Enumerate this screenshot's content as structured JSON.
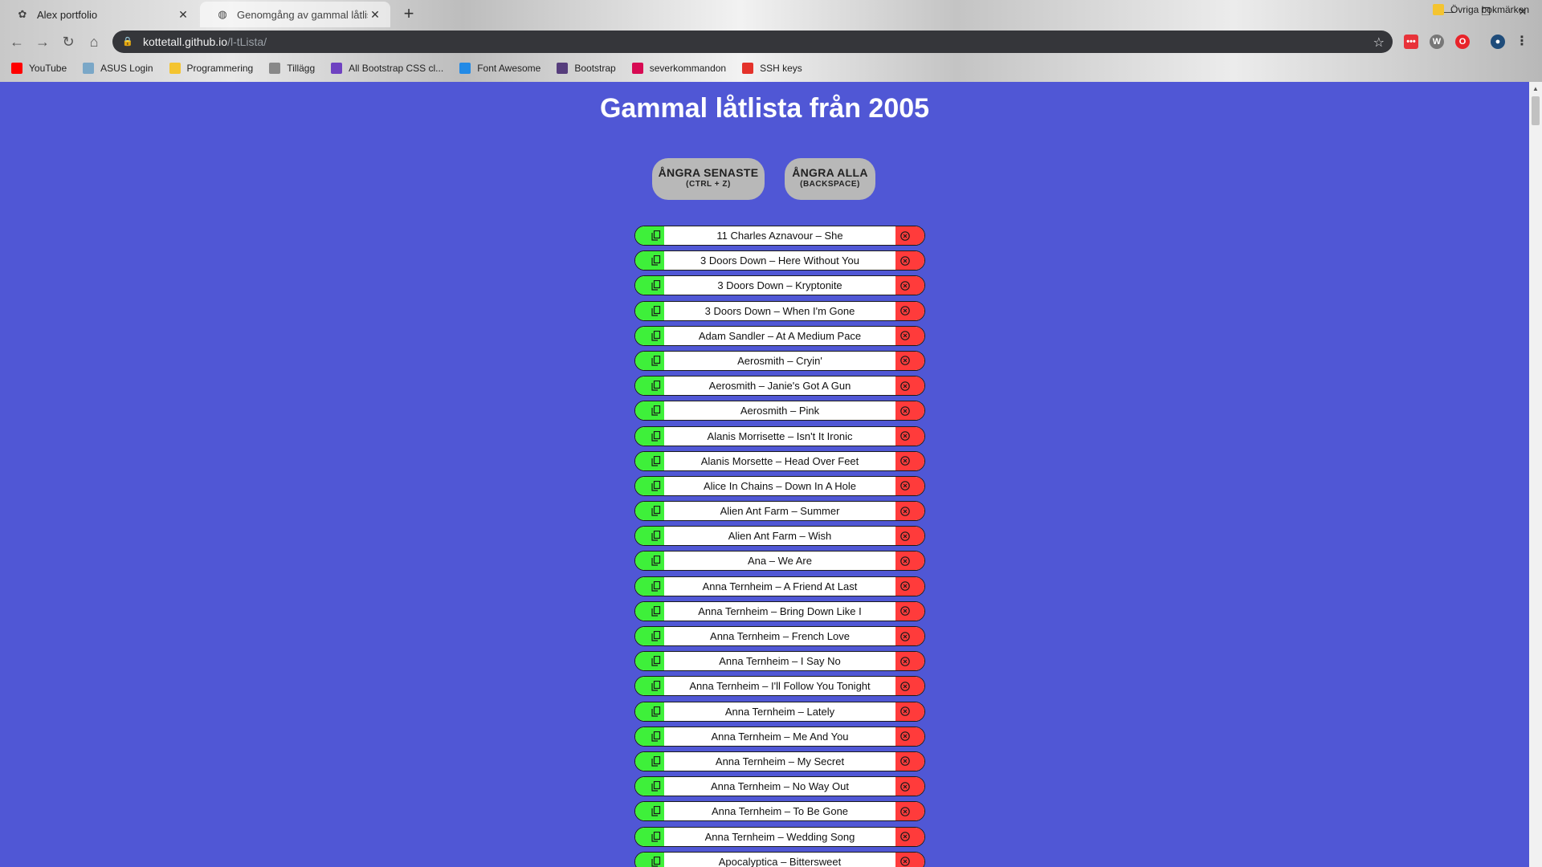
{
  "browser": {
    "tabs": [
      {
        "title": "Alex portfolio",
        "active": false
      },
      {
        "title": "Genomgång av gammal låtlista",
        "active": true
      }
    ],
    "url_host": "kottetall.github.io",
    "url_path": "/l-tLista/",
    "bookmarks": [
      {
        "label": "YouTube",
        "icon": "youtube-icon",
        "color": "#ff0000"
      },
      {
        "label": "ASUS Login",
        "icon": "asus-icon",
        "color": "#7aa7c7"
      },
      {
        "label": "Programmering",
        "icon": "folder-icon",
        "color": "#f4c430"
      },
      {
        "label": "Tillägg",
        "icon": "puzzle-icon",
        "color": "#888888"
      },
      {
        "label": "All Bootstrap CSS cl...",
        "icon": "bootstrap-bookmark-icon",
        "color": "#6f42c1"
      },
      {
        "label": "Font Awesome",
        "icon": "flag-icon",
        "color": "#228ae6"
      },
      {
        "label": "Bootstrap",
        "icon": "bootstrap-icon",
        "color": "#563d7c"
      },
      {
        "label": "severkommandon",
        "icon": "debian-icon",
        "color": "#d70a53"
      },
      {
        "label": "SSH keys",
        "icon": "git-icon",
        "color": "#e4322b"
      }
    ],
    "other_bookmarks": "Övriga bokmärken"
  },
  "page": {
    "title": "Gammal låtlista från 2005",
    "background": "#5057d5",
    "buttons": {
      "undo_last": {
        "label": "ÅNGRA SENASTE",
        "shortcut": "(CTRL + Z)"
      },
      "undo_all": {
        "label": "ÅNGRA ALLA",
        "shortcut": "(BACKSPACE)"
      }
    },
    "copy_color": "#3ef03a",
    "delete_color": "#ff3b3b",
    "songs": [
      "11 Charles Aznavour – She",
      "3 Doors Down – Here Without You",
      "3 Doors Down – Kryptonite",
      "3 Doors Down – When I'm Gone",
      "Adam Sandler – At A Medium Pace",
      "Aerosmith – Cryin'",
      "Aerosmith – Janie's Got A Gun",
      "Aerosmith – Pink",
      "Alanis Morrisette – Isn't It Ironic",
      "Alanis Morsette – Head Over Feet",
      "Alice In Chains – Down In A Hole",
      "Alien Ant Farm – Summer",
      "Alien Ant Farm – Wish",
      "Ana – We Are",
      "Anna Ternheim – A Friend At Last",
      "Anna Ternheim – Bring Down Like I",
      "Anna Ternheim – French Love",
      "Anna Ternheim – I Say No",
      "Anna Ternheim – I'll Follow You Tonight",
      "Anna Ternheim – Lately",
      "Anna Ternheim – Me And You",
      "Anna Ternheim – My Secret",
      "Anna Ternheim – No Way Out",
      "Anna Ternheim – To Be Gone",
      "Anna Ternheim – Wedding Song",
      "Apocalyptica – Bittersweet"
    ]
  }
}
